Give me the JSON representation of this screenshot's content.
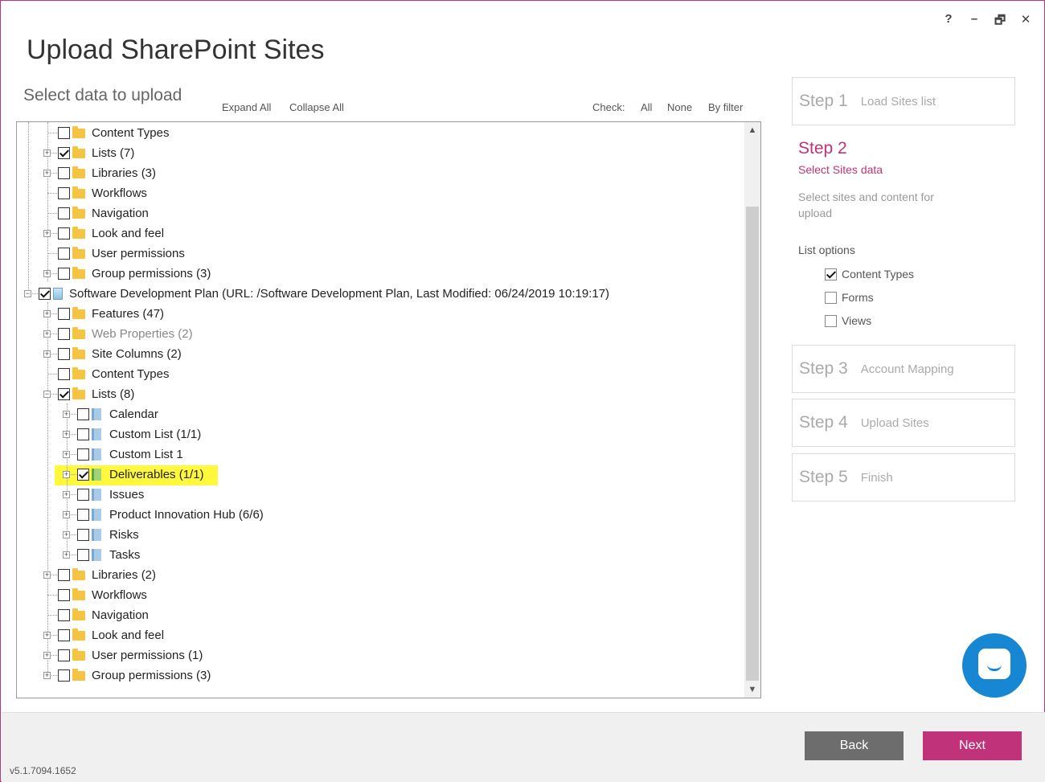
{
  "window": {
    "title": "Upload SharePoint Sites",
    "controls": {
      "help": "?",
      "minimize": "–",
      "restore": "🗗",
      "close": "✕"
    }
  },
  "toolbar": {
    "subtitle": "Select data to upload",
    "expand_all": "Expand All",
    "collapse_all": "Collapse All",
    "check_label": "Check:",
    "check_all": "All",
    "check_none": "None",
    "check_by_filter": "By filter"
  },
  "tree": {
    "rows": [
      {
        "label": "Content Types",
        "checked": false,
        "icon": "folder-icon"
      },
      {
        "label": "Lists (7)",
        "checked": true,
        "icon": "folder-icon"
      },
      {
        "label": "Libraries (3)",
        "checked": false,
        "icon": "folder-icon"
      },
      {
        "label": "Workflows",
        "checked": false,
        "icon": "folder-icon"
      },
      {
        "label": "Navigation",
        "checked": false,
        "icon": "folder-icon"
      },
      {
        "label": "Look and feel",
        "checked": false,
        "icon": "folder-icon"
      },
      {
        "label": "User permissions",
        "checked": false,
        "icon": "folder-icon"
      },
      {
        "label": "Group permissions (3)",
        "checked": false,
        "icon": "folder-icon"
      },
      {
        "label": "Software Development Plan (URL: /Software Development Plan, Last Modified: 06/24/2019 10:19:17)",
        "checked": true,
        "icon": "site-icon"
      },
      {
        "label": "Features (47)",
        "checked": false,
        "icon": "folder-icon"
      },
      {
        "label": "Web Properties (2)",
        "checked": false,
        "icon": "folder-icon",
        "dimmed": true
      },
      {
        "label": "Site Columns (2)",
        "checked": false,
        "icon": "folder-icon"
      },
      {
        "label": "Content Types",
        "checked": false,
        "icon": "folder-icon"
      },
      {
        "label": "Lists (8)",
        "checked": true,
        "icon": "folder-icon"
      },
      {
        "label": "Calendar",
        "checked": false,
        "icon": "list-icon"
      },
      {
        "label": "Custom List (1/1)",
        "checked": false,
        "icon": "list-icon"
      },
      {
        "label": "Custom List 1",
        "checked": false,
        "icon": "list-icon"
      },
      {
        "label": "Deliverables (1/1)",
        "checked": true,
        "icon": "list-icon",
        "highlighted": true
      },
      {
        "label": "Issues",
        "checked": false,
        "icon": "list-icon"
      },
      {
        "label": "Product Innovation Hub (6/6)",
        "checked": false,
        "icon": "list-icon"
      },
      {
        "label": "Risks",
        "checked": false,
        "icon": "list-icon"
      },
      {
        "label": "Tasks",
        "checked": false,
        "icon": "list-icon"
      },
      {
        "label": "Libraries (2)",
        "checked": false,
        "icon": "folder-icon"
      },
      {
        "label": "Workflows",
        "checked": false,
        "icon": "folder-icon"
      },
      {
        "label": "Navigation",
        "checked": false,
        "icon": "folder-icon"
      },
      {
        "label": "Look and feel",
        "checked": false,
        "icon": "folder-icon"
      },
      {
        "label": "User permissions (1)",
        "checked": false,
        "icon": "folder-icon"
      },
      {
        "label": "Group permissions (3)",
        "checked": false,
        "icon": "folder-icon"
      }
    ]
  },
  "wizard": {
    "step1": {
      "num": "Step 1",
      "name": "Load Sites list"
    },
    "step2": {
      "num": "Step 2",
      "sub": "Select Sites data",
      "desc": "Select sites and content for upload",
      "list_options_title": "List options",
      "options": [
        {
          "label": "Content Types",
          "checked": true
        },
        {
          "label": "Forms",
          "checked": false
        },
        {
          "label": "Views",
          "checked": false
        }
      ]
    },
    "step3": {
      "num": "Step 3",
      "name": "Account Mapping"
    },
    "step4": {
      "num": "Step 4",
      "name": "Upload Sites"
    },
    "step5": {
      "num": "Step 5",
      "name": "Finish"
    }
  },
  "footer": {
    "back": "Back",
    "next": "Next",
    "version": "v5.1.7094.1652"
  },
  "colors": {
    "accent": "#c0337a",
    "highlight": "#fff83d",
    "chat": "#1787d4",
    "back_button": "#6d6d6d"
  }
}
